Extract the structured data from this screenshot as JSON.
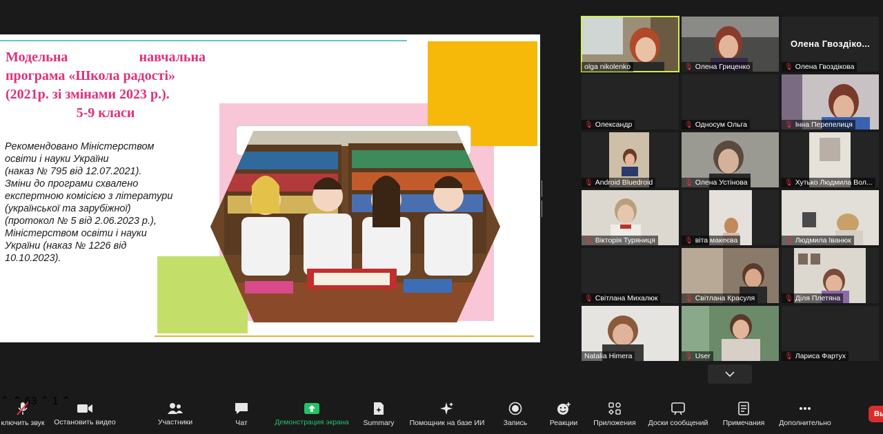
{
  "slide": {
    "title_line1_a": "Модельна",
    "title_line1_b": "навчальна",
    "title_line2": "програма «Школа радості»",
    "title_line3": "(2021р. зі змінами 2023 р.).",
    "title_line4": "5-9 класи",
    "body_lines": [
      "Рекомендовано Міністерством",
      "освіти і науки України",
      "(наказ № 795 від 12.07.2021).",
      "Зміни до програми схвалено",
      "експертною комісією з літератури",
      "(української та зарубіжної)",
      "(протокол № 5 від 2.06.2023 р.),",
      "Міністерством освіти і науки",
      "України (наказ № 1226 від",
      "10.10.2023)."
    ]
  },
  "participants": [
    {
      "name": "olga nikolenko",
      "muted": false
    },
    {
      "name": "Олена Гриценко",
      "muted": true
    },
    {
      "name": "Олена Гвоздікова",
      "muted": true,
      "big_name": "Олена Гвоздіко..."
    },
    {
      "name": "Олександр",
      "muted": true
    },
    {
      "name": "Односум Ольга",
      "muted": true
    },
    {
      "name": "Інна Перепелиця",
      "muted": true
    },
    {
      "name": "Android Bluedroid",
      "muted": true
    },
    {
      "name": "Олена Устінова",
      "muted": true
    },
    {
      "name": "Хутько Людмила Вол...",
      "muted": true
    },
    {
      "name": "Вікторія Туряниця",
      "muted": true
    },
    {
      "name": "віта макеєва",
      "muted": true
    },
    {
      "name": "Людмила Іванюк",
      "muted": true
    },
    {
      "name": "Світлана Михалюк",
      "muted": true
    },
    {
      "name": "Світлана Красуля",
      "muted": true
    },
    {
      "name": "Діля Плетяна",
      "muted": true
    },
    {
      "name": "Natalia Himera",
      "muted": false
    },
    {
      "name": "User",
      "muted": true
    },
    {
      "name": "Лариса Фартух",
      "muted": true
    }
  ],
  "toolbar": {
    "mute_label": "ключить звук",
    "video_label": "Остановить видео",
    "participants_label": "Участники",
    "participants_count": "63",
    "chat_label": "Чат",
    "chat_badge": "1",
    "share_label": "Демонстрация экрана",
    "summary_label": "Summary",
    "ai_label": "Помощник на базе ИИ",
    "record_label": "Запись",
    "reactions_label": "Реакции",
    "apps_label": "Приложения",
    "boards_label": "Доски сообщений",
    "notes_label": "Примечания",
    "more_label": "Дополнительно",
    "end_label": "Вы"
  },
  "colors": {
    "title_pink": "#e0307a",
    "share_green": "#23c26a",
    "active_speaker": "#d6f244",
    "muted_red": "#e5343c"
  }
}
